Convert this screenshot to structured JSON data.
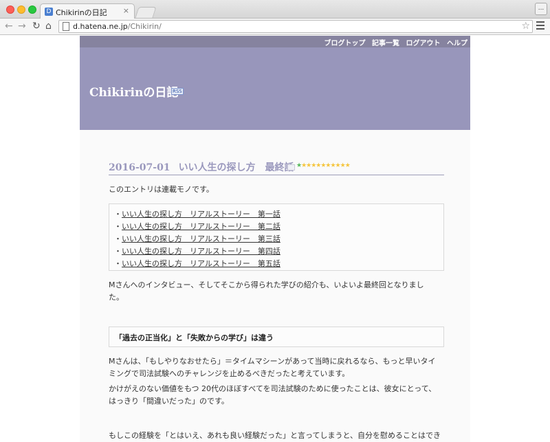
{
  "browser": {
    "tab_title": "Chikirinの日記",
    "tab_favicon": "D",
    "tab_close": "×",
    "url_host": "d.hatena.ne.jp",
    "url_path": "/Chikirin/",
    "menu_dots": "...",
    "icons": [
      "back-arrow-icon",
      "forward-arrow-icon",
      "reload-icon",
      "home-icon",
      "page-icon",
      "star-icon",
      "hamburger-menu-icon"
    ]
  },
  "header": {
    "links": [
      "ブログトップ",
      "記事一覧",
      "ログアウト",
      "ヘルプ"
    ],
    "blog_title": "Chikirinの日記",
    "rss": "RSS"
  },
  "entry": {
    "date": "2016-07-01",
    "title": "いい人生の探し方　最終話",
    "stars_green": "★",
    "stars_yellow": "★★★★★★★★★★",
    "intro": "このエントリは連載モノです。",
    "series": [
      "いい人生の探し方　リアルストーリー　第一話",
      "いい人生の探し方　リアルストーリー　第二話",
      "いい人生の探し方　リアルストーリー　第三話",
      "いい人生の探し方　リアルストーリー　第四話",
      "いい人生の探し方　リアルストーリー　第五話"
    ],
    "para1_line1": "Mさんへのインタビュー、そしてそこから得られた学びの紹介も、いよいよ最終回となりまし",
    "para1_line2": "た。",
    "subheading": "「過去の正当化」と「失敗からの学び」は違う",
    "para2_line1": "Mさんは、「もしやりなおせたら」＝タイムマシーンがあって当時に戻れるなら、もっと早いタイ",
    "para2_line2": "ミングで司法試験へのチャレンジを止めるべきだったと考えています。",
    "para3_line1": "かけがえのない価値をもつ 20代のほぼすべてを司法試験のために使ったことは、彼女にとって、",
    "para3_line2": "はっきり「間違いだった」のです。",
    "para4_line1": "もしこの経験を「とはいえ、あれも良い経験だった」と言ってしまうと、自分を慰めることはでき"
  },
  "colors": {
    "header_bg": "#9896bb",
    "header_bar": "#86839f",
    "title_accent": "#9a98bd"
  }
}
